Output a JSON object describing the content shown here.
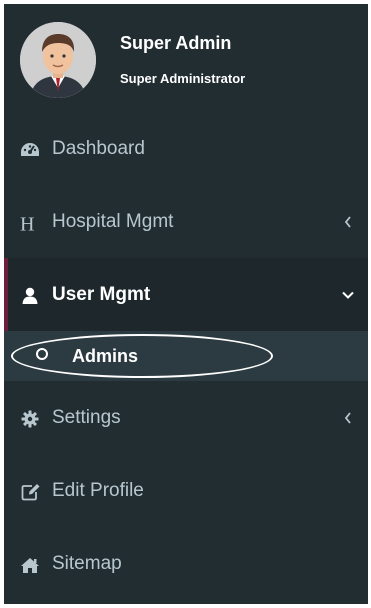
{
  "user": {
    "name": "Super Admin",
    "role": "Super Administrator",
    "avatar_icon": "user-avatar-icon"
  },
  "menu": {
    "items": [
      {
        "label": "Dashboard",
        "icon": "tachometer-icon"
      },
      {
        "label": "Hospital Mgmt",
        "icon": "hospital-h-icon",
        "chevron": "chevron-left-icon"
      },
      {
        "label": "User Mgmt",
        "icon": "user-icon",
        "chevron": "chevron-down-icon",
        "active": true
      },
      {
        "label": "Settings",
        "icon": "gear-icon",
        "chevron": "chevron-left-icon"
      },
      {
        "label": "Edit Profile",
        "icon": "edit-icon"
      },
      {
        "label": "Sitemap",
        "icon": "home-icon"
      }
    ],
    "submenu": [
      {
        "label": "Admins",
        "icon": "circle-icon"
      }
    ]
  },
  "colors": {
    "sidebar_bg": "#222d32",
    "active_bg": "#1e282c",
    "submenu_bg": "#2c3b41",
    "active_border": "#6b1f3a",
    "text": "#b8c7ce",
    "text_active": "#ffffff"
  }
}
